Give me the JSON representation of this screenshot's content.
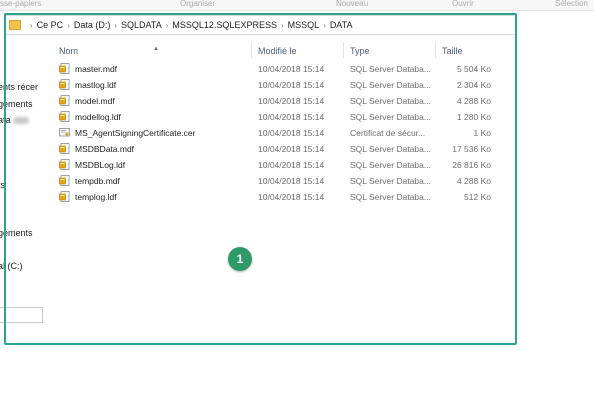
{
  "ribbon": {
    "labels": [
      "sse-papiers",
      "Organiser",
      "Nouveau",
      "Ouvrir",
      "Sélection"
    ]
  },
  "address_bar": {
    "crumbs": [
      "Ce PC",
      "Data (D:)",
      "SQLDATA",
      "MSSQL12.SQLEXPRESS",
      "MSSQL",
      "DATA"
    ]
  },
  "nav_pane": {
    "items": [
      "ents récer",
      "gements",
      "ata",
      "ts",
      "gements",
      "al (C:)"
    ]
  },
  "columns": {
    "name": "Nom",
    "date": "Modifié le",
    "type": "Type",
    "size": "Taille"
  },
  "files": [
    {
      "name": "master.mdf",
      "date": "10/04/2018 15:14",
      "type": "SQL Server Databa...",
      "size": "5 504 Ko",
      "icon": "sql-db-file-icon"
    },
    {
      "name": "mastlog.ldf",
      "date": "10/04/2018 15:14",
      "type": "SQL Server Databa...",
      "size": "2 304 Ko",
      "icon": "sql-db-file-icon"
    },
    {
      "name": "model.mdf",
      "date": "10/04/2018 15:14",
      "type": "SQL Server Databa...",
      "size": "4 288 Ko",
      "icon": "sql-db-file-icon"
    },
    {
      "name": "modellog.ldf",
      "date": "10/04/2018 15:14",
      "type": "SQL Server Databa...",
      "size": "1 280 Ko",
      "icon": "sql-db-file-icon"
    },
    {
      "name": "MS_AgentSigningCertificate.cer",
      "date": "10/04/2018 15:14",
      "type": "Certificat de sécur...",
      "size": "1 Ko",
      "icon": "certificate-icon"
    },
    {
      "name": "MSDBData.mdf",
      "date": "10/04/2018 15:14",
      "type": "SQL Server Databa...",
      "size": "17 536 Ko",
      "icon": "sql-db-file-icon"
    },
    {
      "name": "MSDBLog.ldf",
      "date": "10/04/2018 15:14",
      "type": "SQL Server Databa...",
      "size": "26 816 Ko",
      "icon": "sql-db-file-icon"
    },
    {
      "name": "tempdb.mdf",
      "date": "10/04/2018 15:14",
      "type": "SQL Server Databa...",
      "size": "4 288 Ko",
      "icon": "sql-db-file-icon"
    },
    {
      "name": "templog.ldf",
      "date": "10/04/2018 15:14",
      "type": "SQL Server Databa...",
      "size": "512 Ko",
      "icon": "sql-db-file-icon"
    }
  ],
  "annotation": {
    "badge_number": "1",
    "highlight_color": "#2aa390",
    "badge_color": "#2e9a68"
  }
}
